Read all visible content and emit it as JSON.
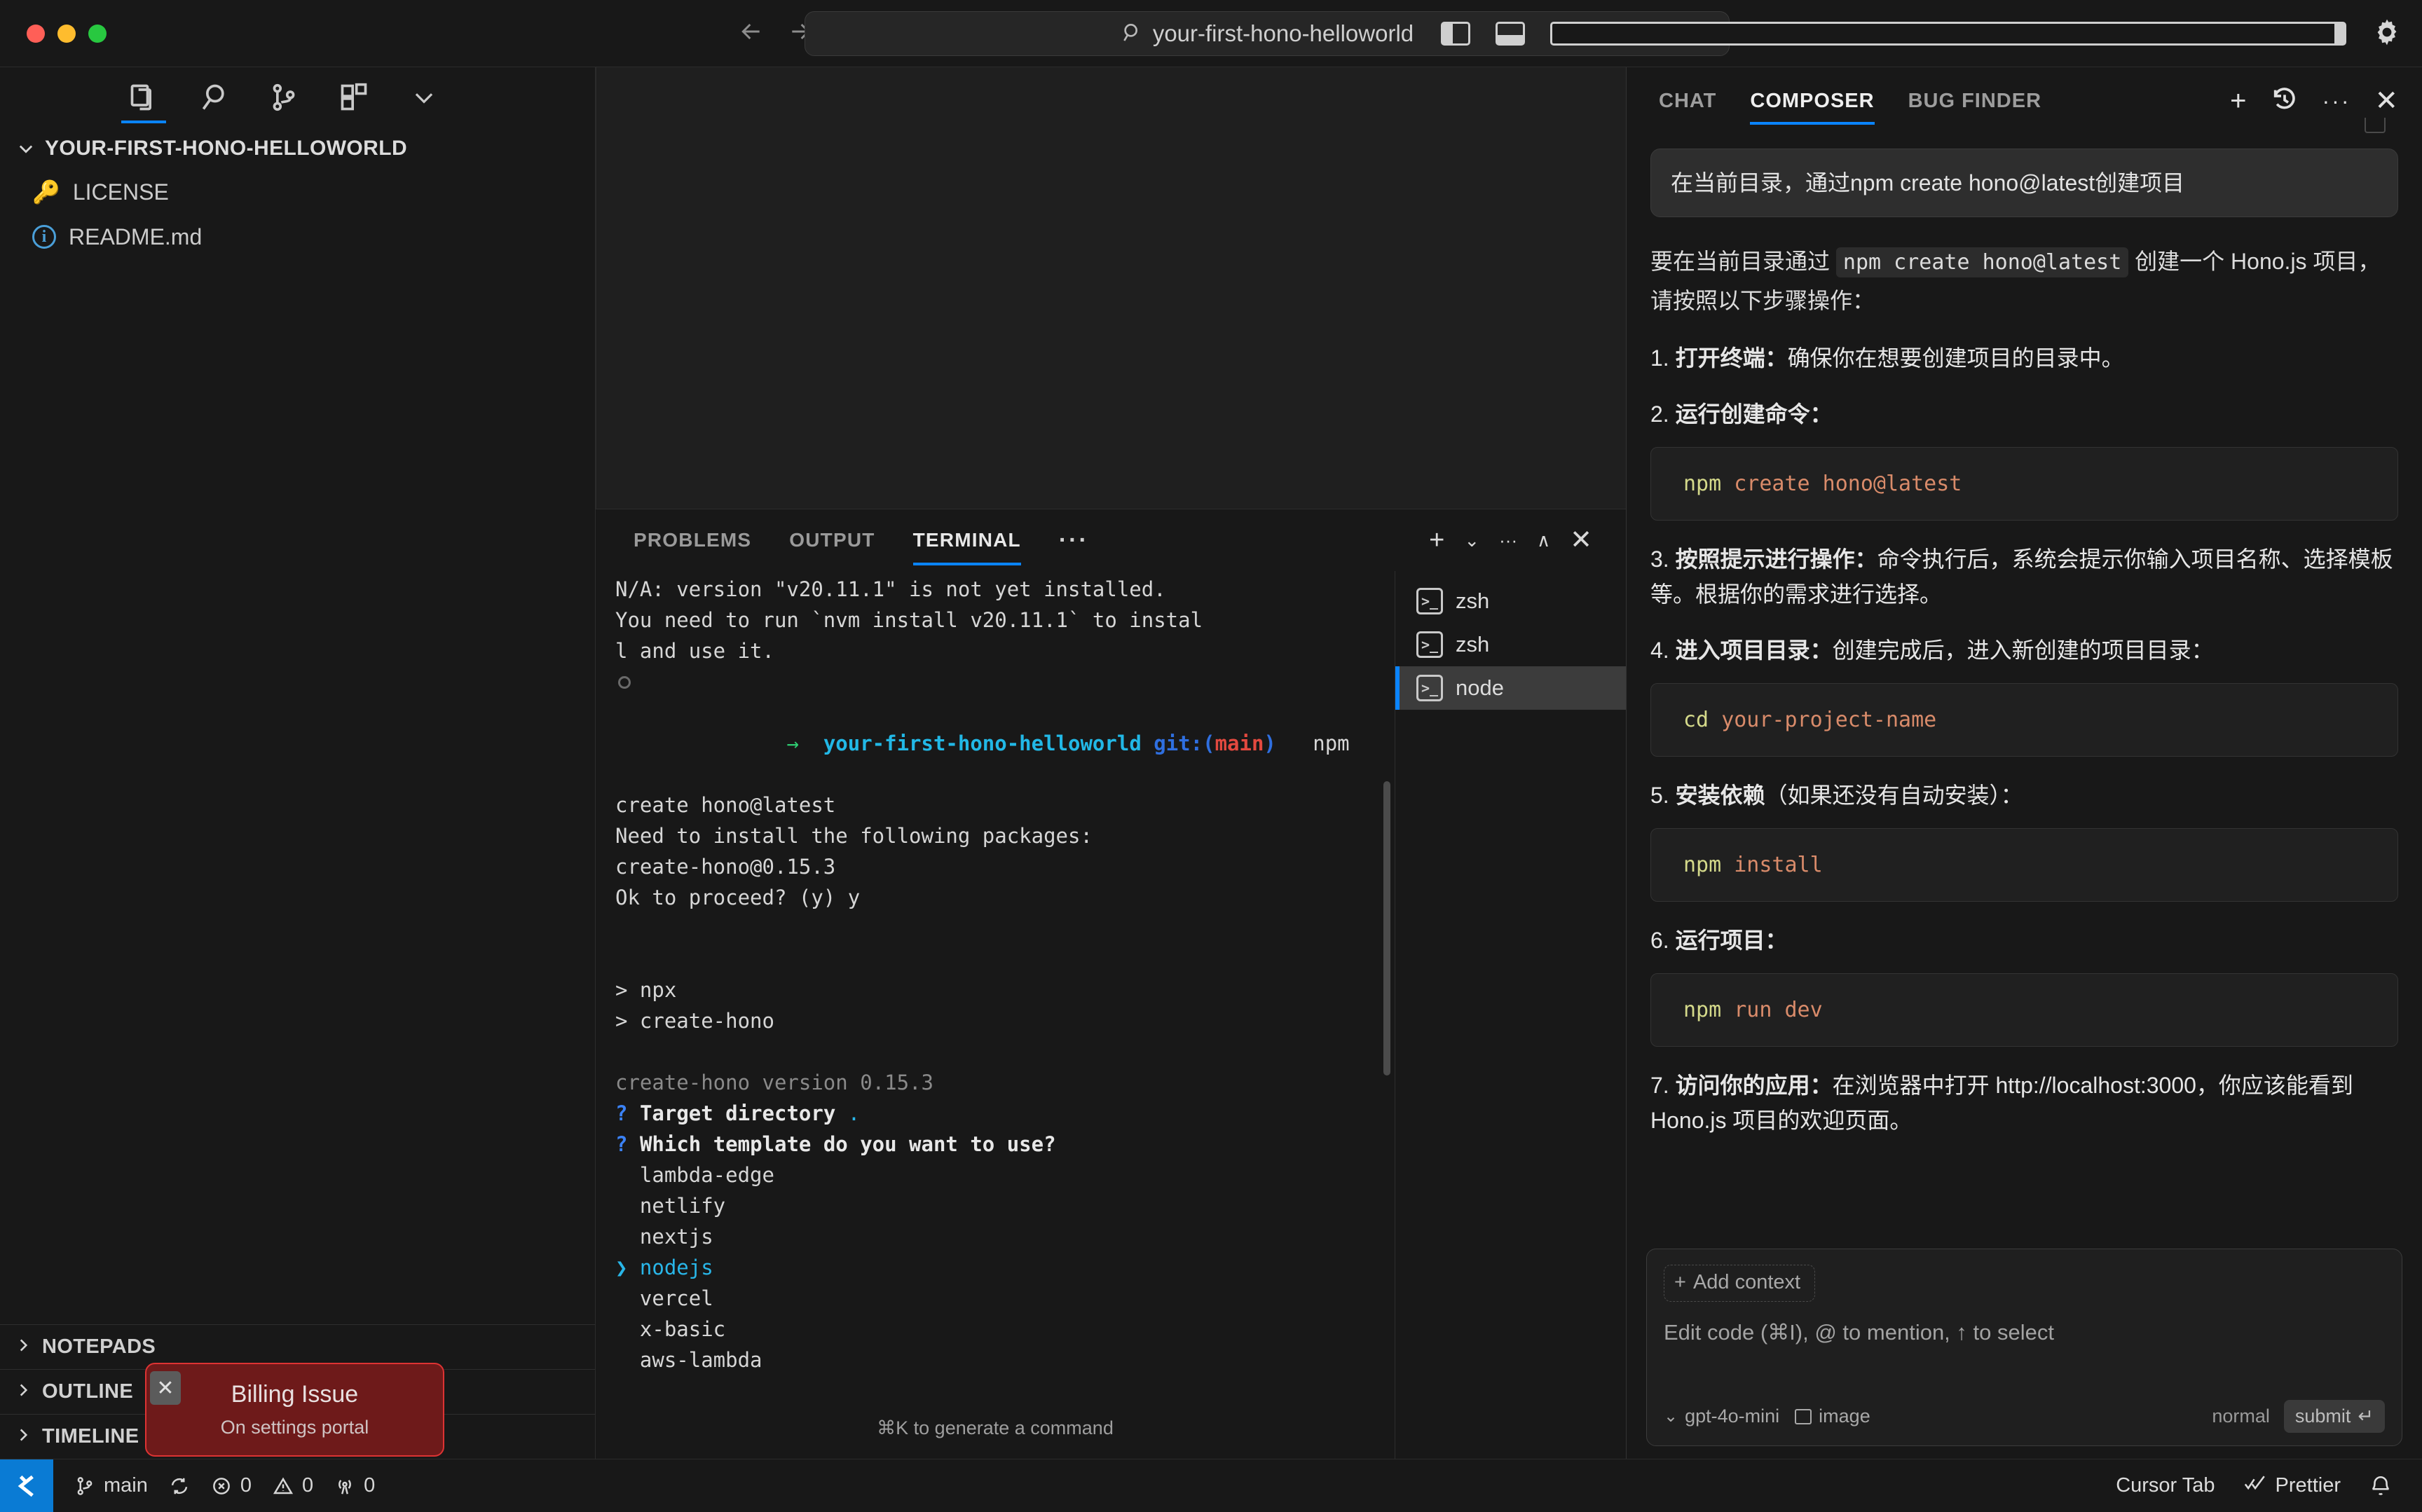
{
  "titlebar": {
    "search_value": "your-first-hono-helloworld",
    "back_icon": "arrow-left-icon",
    "forward_icon": "arrow-right-icon",
    "search_icon": "search-icon",
    "layout_left_icon": "toggle-left-panel-icon",
    "layout_bottom_icon": "toggle-bottom-panel-icon",
    "layout_right_icon": "toggle-right-panel-icon",
    "settings_icon": "gear-icon"
  },
  "sidebar": {
    "toolbar": [
      {
        "name": "explorer-icon",
        "active": true
      },
      {
        "name": "search-icon",
        "active": false
      },
      {
        "name": "source-control-icon",
        "active": false
      },
      {
        "name": "extensions-icon",
        "active": false
      },
      {
        "name": "chevron-down-icon",
        "active": false
      }
    ],
    "root_label": "YOUR-FIRST-HONO-HELLOWORLD",
    "files": [
      {
        "name": "LICENSE",
        "icon": "key-icon"
      },
      {
        "name": "README.md",
        "icon": "info-icon"
      }
    ],
    "sections": [
      "NOTEPADS",
      "OUTLINE",
      "TIMELINE"
    ]
  },
  "panel": {
    "tabs": [
      {
        "label": "PROBLEMS",
        "active": false
      },
      {
        "label": "OUTPUT",
        "active": false
      },
      {
        "label": "TERMINAL",
        "active": true
      }
    ],
    "more_label": "···",
    "actions": {
      "new_terminal": "+",
      "split_chevron": "⌄",
      "more": "···",
      "maximize": "∧",
      "close": "✕"
    },
    "hint": "⌘K to generate a command",
    "terminal_lines": [
      "N/A: version \"v20.11.1\" is not yet installed.",
      "",
      "You need to run `nvm install v20.11.1` to instal",
      "l and use it.",
      "PROMPT",
      "create hono@latest",
      "Need to install the following packages:",
      "create-hono@0.15.3",
      "Ok to proceed? (y) y",
      "",
      "",
      "> npx",
      "> create-hono",
      "",
      "create-hono version 0.15.3",
      "? Target directory .",
      "? Which template do you want to use?",
      "  lambda-edge",
      "  netlify",
      "  nextjs",
      "❯ nodejs",
      "  vercel",
      "  x-basic",
      "  aws-lambda"
    ],
    "prompt": {
      "arrow": "→",
      "dir": "your-first-hono-helloworld",
      "git": "git:(",
      "branch": "main",
      "git_close": ")",
      "command": "npm"
    },
    "terminal_tabs": [
      {
        "label": "zsh",
        "active": false
      },
      {
        "label": "zsh",
        "active": false
      },
      {
        "label": "node",
        "active": true
      }
    ]
  },
  "right_panel": {
    "tabs": [
      {
        "label": "CHAT",
        "active": false
      },
      {
        "label": "COMPOSER",
        "active": true
      },
      {
        "label": "BUG FINDER",
        "active": false
      }
    ],
    "actions": {
      "new": "+",
      "history_icon": "history-icon",
      "more": "···",
      "close": "✕"
    },
    "user_message": "在当前目录，通过npm create hono@latest创建项目",
    "intro_pre": "要在当前目录通过 ",
    "intro_code": "npm create hono@latest",
    "intro_post": " 创建一个 Hono.js 项目，请按照以下步骤操作：",
    "steps": [
      {
        "num": "1.",
        "title": "打开终端：",
        "text": "确保你在想要创建项目的目录中。",
        "code": null
      },
      {
        "num": "2.",
        "title": "运行创建命令：",
        "text": "",
        "code": {
          "cmd": "npm",
          "args": "create hono@latest"
        }
      },
      {
        "num": "3.",
        "title": "按照提示进行操作：",
        "text": "命令执行后，系统会提示你输入项目名称、选择模板等。根据你的需求进行选择。",
        "code": null
      },
      {
        "num": "4.",
        "title": "进入项目目录：",
        "text": "创建完成后，进入新创建的项目目录：",
        "code": {
          "cmd": "cd",
          "args": "your-project-name"
        }
      },
      {
        "num": "5.",
        "title": "安装依赖",
        "text": "（如果还没有自动安装）：",
        "code": {
          "cmd": "npm",
          "args": "install"
        }
      },
      {
        "num": "6.",
        "title": "运行项目：",
        "text": "",
        "code": {
          "cmd": "npm",
          "args": "run dev"
        }
      }
    ],
    "step7": {
      "num": "7.",
      "title": "访问你的应用：",
      "pre": "在浏览器中打开 ",
      "url": "http://localhost:3000",
      "post": "，你应该能看到 Hono.js 项目的欢迎页面。"
    },
    "composer": {
      "add_context_label": "Add context",
      "add_context_icon": "plus-icon",
      "placeholder": "Edit code (⌘I), @ to mention, ↑ to select",
      "model": "gpt-4o-mini",
      "model_chevron": "⌄",
      "image_label": "image",
      "image_icon": "image-icon",
      "mode": "normal",
      "submit_label": "submit",
      "submit_icon": "enter-icon"
    }
  },
  "notification": {
    "title": "Billing Issue",
    "subtitle": "On settings portal",
    "close_icon": "close-icon",
    "color": "#6e1a1a",
    "border_color": "#d33333"
  },
  "statusbar": {
    "logo_icon": "cursor-logo-icon",
    "branch": "main",
    "branch_icon": "source-control-icon",
    "sync_icon": "sync-icon",
    "errors": "0",
    "error_icon": "error-circle-icon",
    "warnings": "0",
    "warning_icon": "warning-triangle-icon",
    "radio": "0",
    "radio_icon": "radio-tower-icon",
    "cursor_tab": "Cursor Tab",
    "prettier": "Prettier",
    "prettier_icon": "check-check-icon",
    "bell_icon": "bell-icon"
  }
}
